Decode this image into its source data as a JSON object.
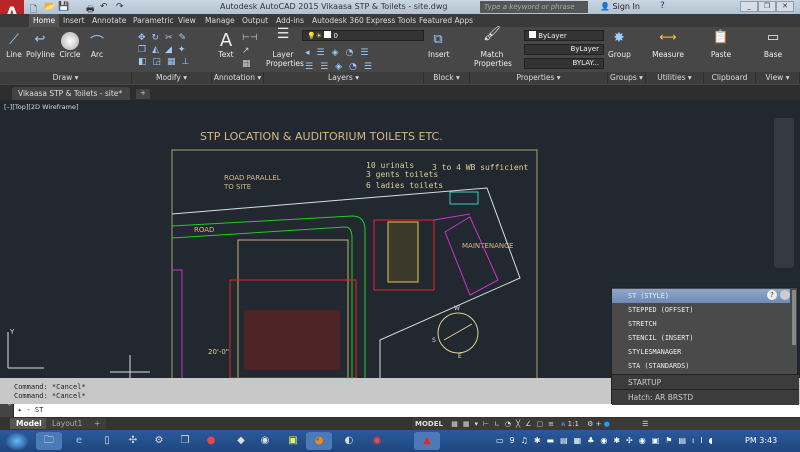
{
  "app": {
    "title": "Autodesk AutoCAD 2015   Vikaasa STP & Toilets - site.dwg",
    "logo": "A",
    "search_placeholder": "Type a keyword or phrase",
    "sign_in": "Sign In"
  },
  "ribbon_tabs": [
    "Home",
    "Insert",
    "Annotate",
    "Parametric",
    "View",
    "Manage",
    "Output",
    "Add-ins",
    "Autodesk 360",
    "Express Tools",
    "Featured Apps"
  ],
  "active_tab": "Home",
  "draw": {
    "line": "Line",
    "polyline": "Polyline",
    "circle": "Circle",
    "arc": "Arc",
    "label": "Draw ▾"
  },
  "modify": {
    "label": "Modify ▾"
  },
  "annotation": {
    "text": "Text",
    "label": "Annotation ▾"
  },
  "layers": {
    "layer_properties": "Layer\nProperties",
    "current_layer": "0",
    "label": "Layers ▾"
  },
  "block": {
    "insert": "Insert",
    "label": "Block ▾"
  },
  "properties": {
    "match": "Match\nProperties",
    "color": "ByLayer",
    "linetype": "ByLayer",
    "lineweight": "BYLAY...",
    "label": "Properties ▾"
  },
  "groups": {
    "group": "Group",
    "label": "Groups ▾"
  },
  "utilities": {
    "measure": "Measure",
    "label": "Utilities ▾"
  },
  "clipboard": {
    "paste": "Paste",
    "label": "Clipboard"
  },
  "view": {
    "base": "Base",
    "label": "View ▾"
  },
  "file_tab": "Vikaasa STP & Toilets - site*",
  "viewport_label": "[–][Top][2D Wireframe]",
  "drawing": {
    "title": "STP LOCATION & AUDITORIUM TOILETS ETC.",
    "note1": "10 urinals",
    "note2": "3 gents toilets",
    "note3": "6 ladies toilets",
    "note4": "3 to 4 WB sufficient",
    "road_parallel": "ROAD PARALLEL",
    "to_site": "TO SITE",
    "road": "ROAD",
    "maintenance": "MAINTENANCE",
    "dim": "20'-0\"",
    "compass_w": "W",
    "compass_s": "S",
    "compass_e": "E"
  },
  "command": {
    "history": [
      "Command: *Cancel*",
      "Command: *Cancel*"
    ],
    "input": "▸ - ST"
  },
  "autocomplete": {
    "items": [
      "ST (STYLE)",
      "STEPPED (OFFSET)",
      "STRETCH",
      "STENCIL (INSERT)",
      "STYLESMANAGER",
      "STA (STANDARDS)"
    ],
    "sections": [
      "STARTUP",
      "Hatch: AR BRSTD"
    ]
  },
  "layout_tabs": [
    "Model",
    "Layout1",
    "+"
  ],
  "status": {
    "model": "MODEL",
    "scale": "1:1"
  },
  "clock": "PM 3:43"
}
